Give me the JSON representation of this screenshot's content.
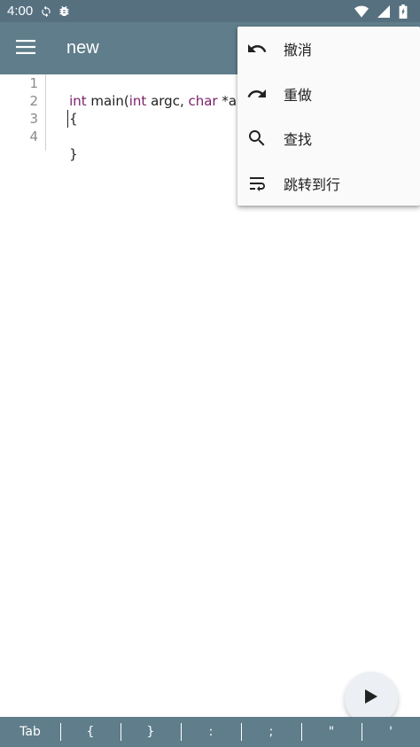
{
  "status_bar": {
    "time": "4:00",
    "icons": [
      "sync-icon",
      "bug-icon",
      "wifi-icon",
      "signal-icon",
      "battery-icon"
    ]
  },
  "app_bar": {
    "title": "new",
    "menu_icon": "hamburger-menu-icon"
  },
  "editor": {
    "line_numbers": [
      "1",
      "2",
      "3",
      "4"
    ],
    "lines": [
      {
        "parts": [
          {
            "text": "int",
            "kw": true
          },
          {
            "text": " main(",
            "kw": false
          },
          {
            "text": "int",
            "kw": true
          },
          {
            "text": " argc, ",
            "kw": false
          },
          {
            "text": "char",
            "kw": true
          },
          {
            "text": " *argv",
            "kw": false
          }
        ]
      },
      {
        "parts": [
          {
            "text": "{",
            "kw": false
          }
        ]
      },
      {
        "parts": [
          {
            "text": "",
            "kw": false
          }
        ]
      },
      {
        "parts": [
          {
            "text": "}",
            "kw": false
          }
        ]
      }
    ],
    "keyword_color": "#7a1f66"
  },
  "popup_menu": {
    "items": [
      {
        "label": "撤消",
        "icon": "undo-icon"
      },
      {
        "label": "重做",
        "icon": "redo-icon"
      },
      {
        "label": "查找",
        "icon": "search-icon"
      },
      {
        "label": "跳转到行",
        "icon": "wrap-text-icon"
      }
    ]
  },
  "fab": {
    "icon": "play-icon"
  },
  "symbol_bar": {
    "keys": [
      "Tab",
      "{",
      "}",
      ":",
      ";",
      "\"",
      "'"
    ]
  },
  "colors": {
    "app_bar": "#607d8b",
    "status_bar": "#56707f",
    "menu_background": "#fafafa"
  }
}
